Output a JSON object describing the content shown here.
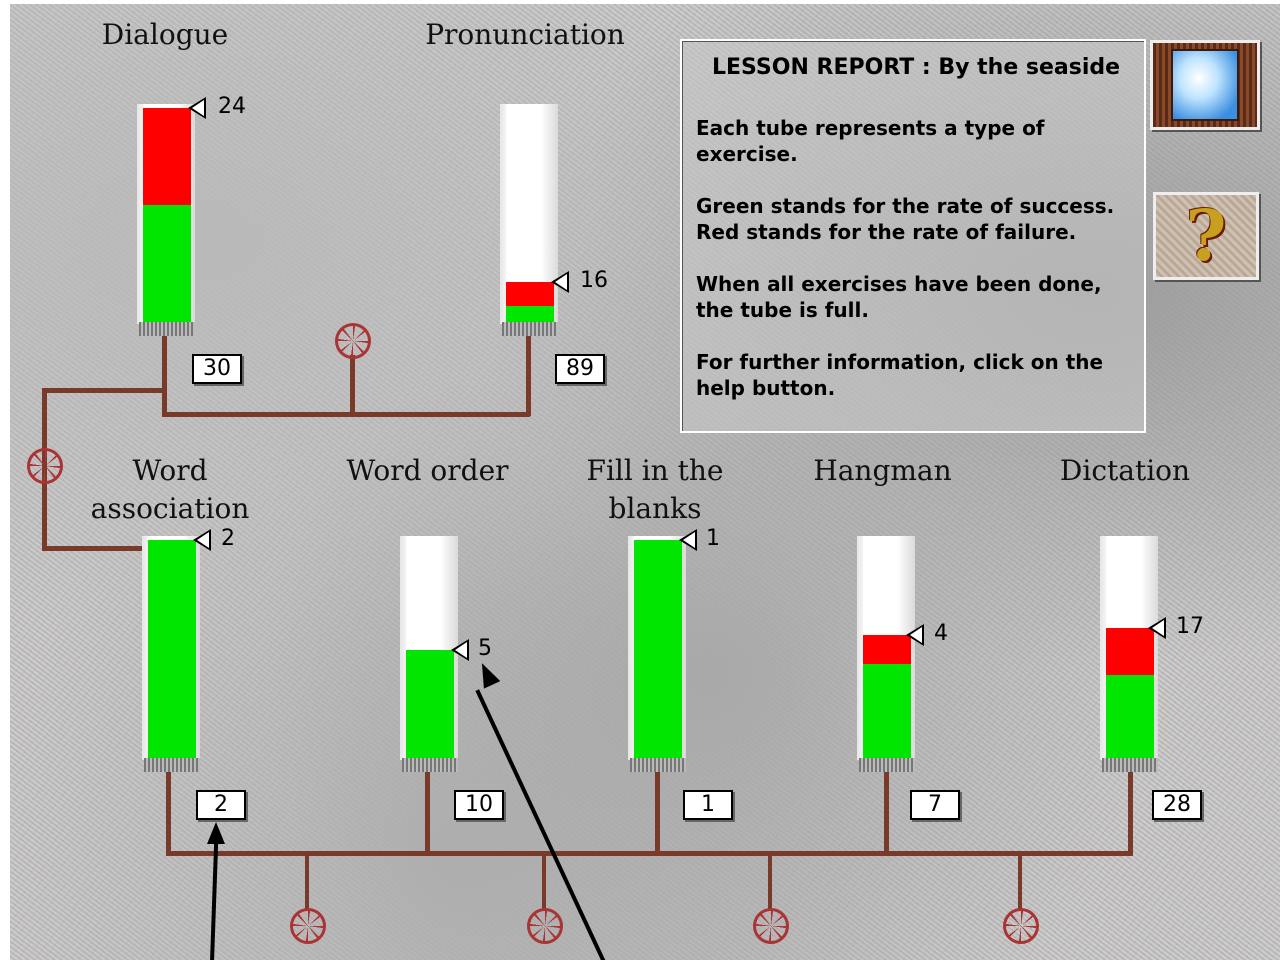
{
  "report": {
    "title": "LESSON REPORT : By the seaside",
    "para1": "Each tube represents a type of exercise.",
    "para2": "Green stands for the rate of success. Red stands for the rate of failure.",
    "para3": "When all exercises have been done, the tube is full.",
    "para4": "For further information, click on the help button."
  },
  "colors": {
    "success": "#00e600",
    "failure": "#ff0000",
    "pipe": "#7a3a2a"
  },
  "buttons": {
    "exit_icon": "window-sky-icon",
    "help_icon": "question-mark-icon"
  },
  "tubes": [
    {
      "label_line1": "Dialogue",
      "label_line2": "",
      "red_fraction": 0.44,
      "green_fraction": 0.54,
      "failures": "24",
      "count": "30"
    },
    {
      "label_line1": "Pronunciation",
      "label_line2": "",
      "red_fraction": 0.11,
      "green_fraction": 0.08,
      "failures": "16",
      "count": "89"
    },
    {
      "label_line1": "Word",
      "label_line2": "association",
      "red_fraction": 0.0,
      "green_fraction": 0.98,
      "failures": "2",
      "count": "2"
    },
    {
      "label_line1": "Word order",
      "label_line2": "",
      "red_fraction": 0.0,
      "green_fraction": 0.49,
      "failures": "5",
      "count": "10"
    },
    {
      "label_line1": "Fill in the",
      "label_line2": "blanks",
      "red_fraction": 0.0,
      "green_fraction": 0.98,
      "failures": "1",
      "count": "1"
    },
    {
      "label_line1": "Hangman",
      "label_line2": "",
      "red_fraction": 0.13,
      "green_fraction": 0.43,
      "failures": "4",
      "count": "7"
    },
    {
      "label_line1": "Dictation",
      "label_line2": "",
      "red_fraction": 0.21,
      "green_fraction": 0.38,
      "failures": "17",
      "count": "28"
    }
  ]
}
